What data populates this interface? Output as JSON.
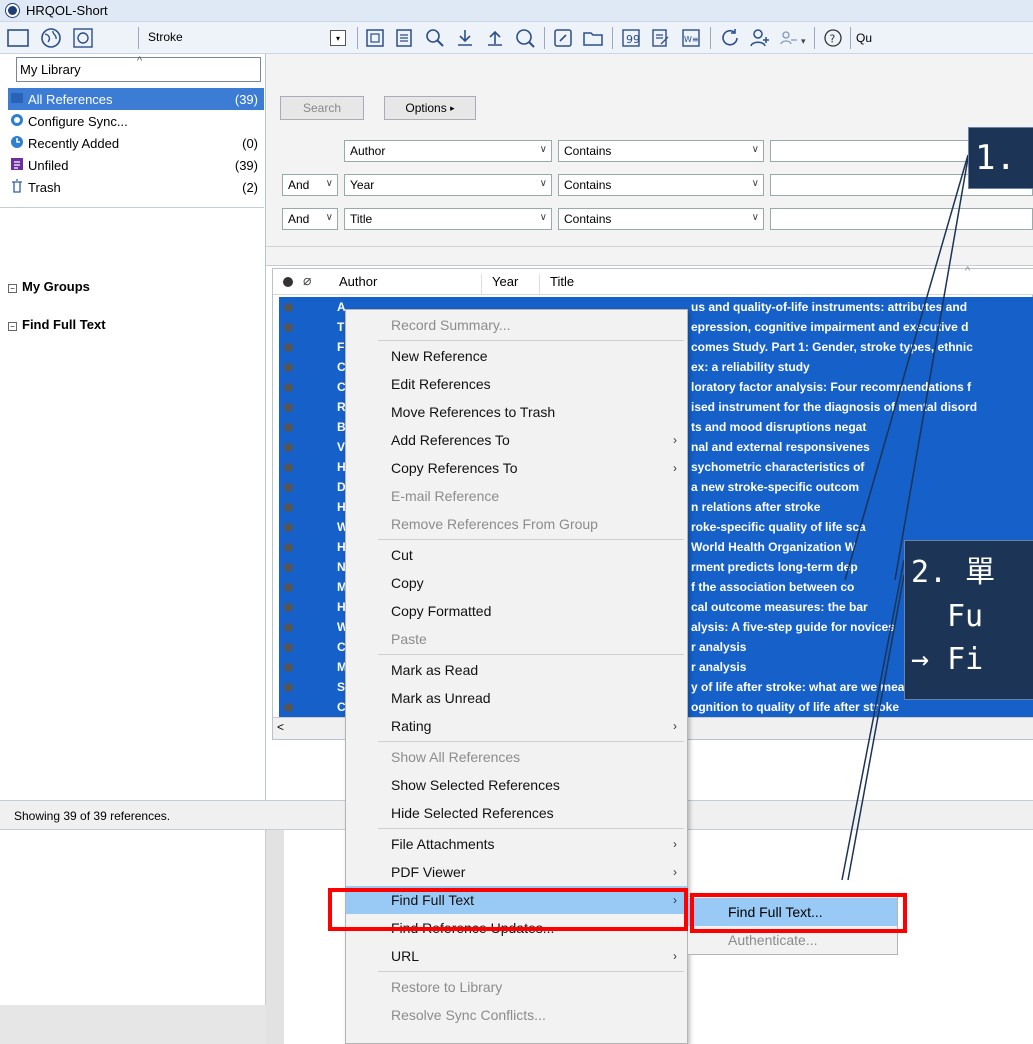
{
  "window": {
    "title": "HRQOL-Short"
  },
  "toolbar": {
    "group": "Stroke",
    "quick_search": "Qu"
  },
  "library": {
    "box_label": "My Library",
    "items": [
      {
        "label": "All References",
        "count": "(39)"
      },
      {
        "label": "Configure Sync...",
        "count": ""
      },
      {
        "label": "Recently Added",
        "count": "(0)"
      },
      {
        "label": "Unfiled",
        "count": "(39)"
      },
      {
        "label": "Trash",
        "count": "(2)"
      }
    ],
    "groups": [
      "My Groups",
      "Find Full Text"
    ]
  },
  "search": {
    "search_btn": "Search",
    "options_btn": "Options",
    "rows": [
      {
        "bool": "",
        "field": "Author",
        "op": "Contains"
      },
      {
        "bool": "And",
        "field": "Year",
        "op": "Contains"
      },
      {
        "bool": "And",
        "field": "Title",
        "op": "Contains"
      }
    ]
  },
  "list": {
    "headers": {
      "author": "Author",
      "year": "Year",
      "title": "Title"
    },
    "rows": [
      {
        "ini": "A",
        "title": "us and quality-of-life instruments: attributes and"
      },
      {
        "ini": "T",
        "title": "epression, cognitive impairment and executive d"
      },
      {
        "ini": "F",
        "title": "comes Study. Part 1: Gender, stroke types, ethnic"
      },
      {
        "ini": "C",
        "title": "ex: a reliability study"
      },
      {
        "ini": "C",
        "title": "loratory factor analysis: Four recommendations f"
      },
      {
        "ini": "R",
        "title": "ised instrument for the diagnosis of mental disord"
      },
      {
        "ini": "B",
        "title": "ts and mood disruptions negat"
      },
      {
        "ini": "V",
        "title": "nal and external responsivenes"
      },
      {
        "ini": "H",
        "title": "sychometric characteristics of"
      },
      {
        "ini": "D",
        "title": "a new stroke-specific outcom"
      },
      {
        "ini": "H",
        "title": "n relations after stroke"
      },
      {
        "ini": "W",
        "title": "roke-specific quality of life sca"
      },
      {
        "ini": "H",
        "title": "World Health Organization W"
      },
      {
        "ini": "N",
        "title": "rment predicts long-term dep"
      },
      {
        "ini": "M",
        "title": "f the association between co"
      },
      {
        "ini": "H",
        "title": "cal outcome measures: the bar"
      },
      {
        "ini": "W",
        "title": "alysis: A five-step guide for novices"
      },
      {
        "ini": "C",
        "title": "r analysis"
      },
      {
        "ini": "M",
        "title": "r analysis"
      },
      {
        "ini": "S",
        "title": "y of life after stroke: what are we measuring?"
      },
      {
        "ini": "C",
        "title": "ognition to quality of life after stroke"
      }
    ]
  },
  "status": {
    "text": "Showing 39 of 39 references."
  },
  "context_menu": {
    "items": [
      {
        "label": "Record Summary...",
        "disabled": true
      },
      {
        "label": "New Reference"
      },
      {
        "label": "Edit References"
      },
      {
        "label": "Move References to Trash"
      },
      {
        "label": "Add References To",
        "sub": true
      },
      {
        "label": "Copy References To",
        "sub": true
      },
      {
        "label": "E-mail Reference",
        "disabled": true
      },
      {
        "label": "Remove References From Group",
        "disabled": true
      },
      {
        "label": "Cut"
      },
      {
        "label": "Copy"
      },
      {
        "label": "Copy Formatted"
      },
      {
        "label": "Paste",
        "disabled": true
      },
      {
        "label": "Mark as Read"
      },
      {
        "label": "Mark as Unread"
      },
      {
        "label": "Rating",
        "sub": true
      },
      {
        "label": "Show All References",
        "disabled": true
      },
      {
        "label": "Show Selected References"
      },
      {
        "label": "Hide Selected References"
      },
      {
        "label": "File Attachments",
        "sub": true
      },
      {
        "label": "PDF Viewer",
        "sub": true
      },
      {
        "label": "Find Full Text",
        "sub": true,
        "highlight": true
      },
      {
        "label": "Find Reference Updates..."
      },
      {
        "label": "URL",
        "sub": true
      },
      {
        "label": "Restore to Library",
        "disabled": true
      },
      {
        "label": "Resolve Sync Conflicts...",
        "disabled": true
      }
    ]
  },
  "submenu": {
    "items": [
      {
        "label": "Find Full Text...",
        "highlight": true
      },
      {
        "label": "Authenticate...",
        "disabled": true
      }
    ]
  },
  "callouts": {
    "c1": "1.",
    "c2_line1": "2. 單",
    "c2_line2": "Fu",
    "c2_line3": "→ Fi"
  },
  "colors": {
    "selection": "#1560c9",
    "menu_highlight": "#99c9f5",
    "callout_bg": "#1c3455",
    "annotation_red": "#ff0000"
  }
}
